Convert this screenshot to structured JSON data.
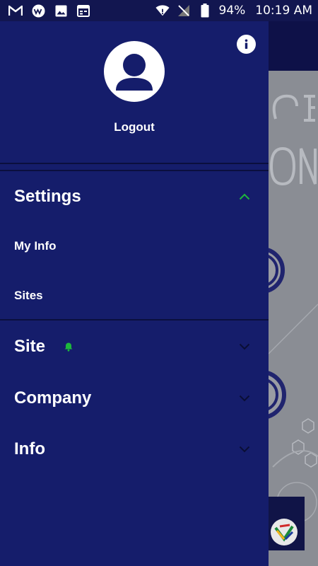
{
  "status_bar": {
    "icons": [
      "gmail-icon",
      "app-logo-icon",
      "image-icon",
      "calendar-icon"
    ],
    "battery": "94%",
    "time": "10:19 AM"
  },
  "drawer": {
    "logout_label": "Logout",
    "sections": [
      {
        "label": "Settings",
        "expanded": true,
        "items": [
          "My Info",
          "Sites"
        ]
      },
      {
        "label": "Site",
        "expanded": false,
        "notification": true
      },
      {
        "label": "Company",
        "expanded": false
      },
      {
        "label": "Info",
        "expanded": false
      }
    ]
  },
  "colors": {
    "drawer_bg": "#151d6b",
    "accent_green": "#1db83c",
    "status_bar_bg": "#121650"
  }
}
